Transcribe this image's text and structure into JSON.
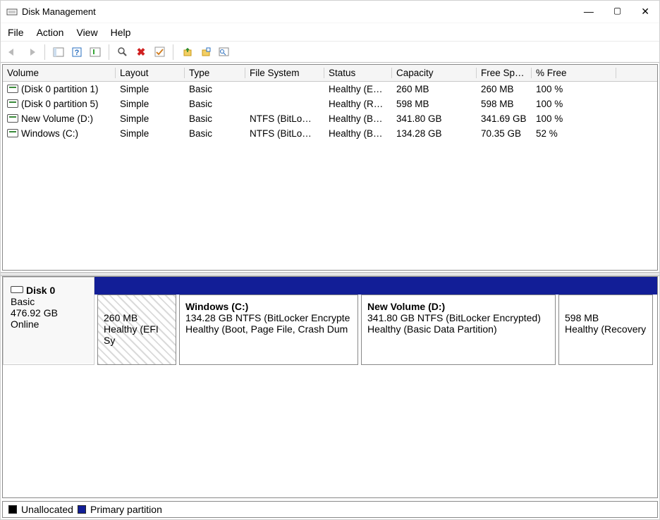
{
  "titlebar": {
    "title": "Disk Management"
  },
  "menubar": {
    "file": "File",
    "action": "Action",
    "view": "View",
    "help": "Help"
  },
  "columns": {
    "volume": "Volume",
    "layout": "Layout",
    "type": "Type",
    "fs": "File System",
    "status": "Status",
    "capacity": "Capacity",
    "free": "Free Sp…",
    "pct": "% Free"
  },
  "volumes": [
    {
      "name": "(Disk 0 partition 1)",
      "layout": "Simple",
      "type": "Basic",
      "fs": "",
      "status": "Healthy (E…",
      "cap": "260 MB",
      "free": "260 MB",
      "pct": "100 %"
    },
    {
      "name": "(Disk 0 partition 5)",
      "layout": "Simple",
      "type": "Basic",
      "fs": "",
      "status": "Healthy (R…",
      "cap": "598 MB",
      "free": "598 MB",
      "pct": "100 %"
    },
    {
      "name": "New Volume (D:)",
      "layout": "Simple",
      "type": "Basic",
      "fs": "NTFS (BitLo…",
      "status": "Healthy (B…",
      "cap": "341.80 GB",
      "free": "341.69 GB",
      "pct": "100 %"
    },
    {
      "name": "Windows (C:)",
      "layout": "Simple",
      "type": "Basic",
      "fs": "NTFS (BitLo…",
      "status": "Healthy (B…",
      "cap": "134.28 GB",
      "free": "70.35 GB",
      "pct": "52 %"
    }
  ],
  "disk": {
    "title": "Disk 0",
    "type": "Basic",
    "size": "476.92 GB",
    "state": "Online",
    "partitions": {
      "p1": {
        "size": "260 MB",
        "status": "Healthy (EFI Sy"
      },
      "p2": {
        "label": "Windows  (C:)",
        "detail": "134.28 GB NTFS (BitLocker Encrypte",
        "status": "Healthy (Boot, Page File, Crash Dum"
      },
      "p3": {
        "label": "New Volume  (D:)",
        "detail": "341.80 GB NTFS (BitLocker Encrypted)",
        "status": "Healthy (Basic Data Partition)"
      },
      "p4": {
        "size": "598 MB",
        "status": "Healthy (Recovery"
      }
    }
  },
  "legend": {
    "unallocated": "Unallocated",
    "primary": "Primary partition"
  }
}
